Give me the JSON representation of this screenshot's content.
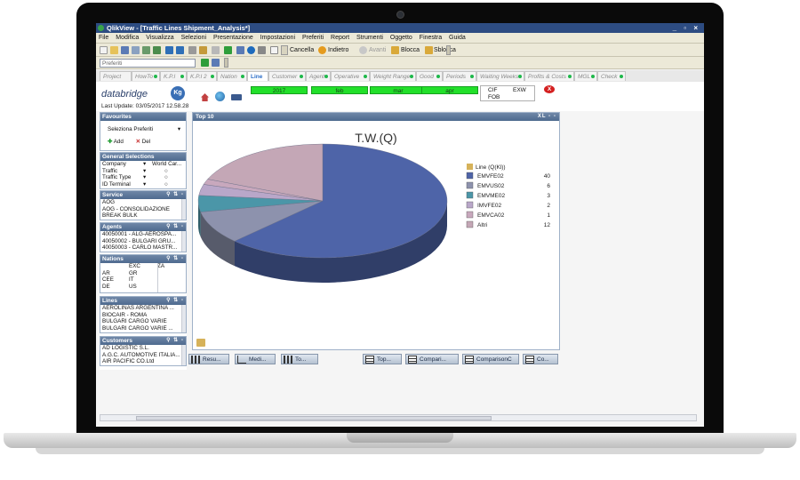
{
  "window": {
    "title": "QlikView - [Traffic Lines Shipment_Analysis*]",
    "controls": "_ ▫ ×"
  },
  "menu": [
    "File",
    "Modifica",
    "Visualizza",
    "Selezioni",
    "Presentazione",
    "Impostazioni",
    "Preferiti",
    "Report",
    "Strumenti",
    "Oggetto",
    "Finestra",
    "Guida"
  ],
  "toolbar": {
    "cancella": "Cancella",
    "indietro": "Indietro",
    "avanti": "Avanti",
    "blocca": "Blocca",
    "sblocca": "Sblocca"
  },
  "preferiti_placeholder": "Preferiti",
  "tabs": [
    {
      "label": "Project",
      "dot": false
    },
    {
      "label": "HowTo",
      "dot": true
    },
    {
      "label": "K.P.I",
      "dot": true
    },
    {
      "label": "K.P.I 2",
      "dot": true
    },
    {
      "label": "Nation",
      "dot": true
    },
    {
      "label": "Line",
      "dot": false,
      "active": true
    },
    {
      "label": "Customer",
      "dot": true
    },
    {
      "label": "Agent",
      "dot": true
    },
    {
      "label": "Operative",
      "dot": true
    },
    {
      "label": "Weight Range",
      "dot": true
    },
    {
      "label": "Good",
      "dot": true
    },
    {
      "label": "Periods",
      "dot": true
    },
    {
      "label": "Waiting Weeks",
      "dot": true
    },
    {
      "label": "Profits & Costs",
      "dot": true
    },
    {
      "label": "MGL",
      "dot": true
    },
    {
      "label": "Check",
      "dot": true
    }
  ],
  "brand": {
    "logo": "databridge",
    "badge": "Kg",
    "last_update": "Last Update: 03/05/2017 12.58.28"
  },
  "period_filters": [
    "2017",
    "feb",
    "mar",
    "apr"
  ],
  "incoterms": {
    "cif": "CIF",
    "exw": "EXW",
    "fob": "FOB"
  },
  "clear_button": "X",
  "favourites": {
    "title": "Favourites",
    "select_label": "Seleziona Preferiti",
    "add": "Add",
    "del": "Del"
  },
  "general_selections": {
    "title": "General Selections",
    "rows": [
      {
        "label": "Company",
        "value": "World Car..."
      },
      {
        "label": "Traffic",
        "value": ""
      },
      {
        "label": "Traffic Type",
        "value": ""
      },
      {
        "label": "ID Terminal",
        "value": ""
      }
    ]
  },
  "service": {
    "title": "Service",
    "items": [
      "AOG",
      "AOG - CONSOLIDAZIONE",
      "BREAK BULK"
    ]
  },
  "agents": {
    "title": "Agents",
    "items": [
      "40050001 - ALG-AEROSPA...",
      "40050002 - BULGARI GRU...",
      "40050003 - CARLO MASTR..."
    ]
  },
  "nations": {
    "title": "Nations",
    "headers": [
      "",
      "EXC",
      "ZA"
    ],
    "rows": [
      [
        "AR",
        "GR",
        ""
      ],
      [
        "CEE",
        "IT",
        ""
      ],
      [
        "DE",
        "US",
        ""
      ]
    ]
  },
  "lines": {
    "title": "Lines",
    "items": [
      "AEROLINAS ARGENTINA ...",
      "BIOCAIR - ROMA",
      "BULGARI CARGO VARIE",
      "BULGARI CARGO VARIE ..."
    ]
  },
  "customers": {
    "title": "Customers",
    "items": [
      "AD LOGISTIC S.L.",
      "A.G.C. AUTOMOTIVE ITALIA...",
      "AIR PACIFIC CO.Ltd"
    ]
  },
  "top10": {
    "title": "Top 10",
    "icons": "XL ▫ ▫"
  },
  "chart_data": {
    "type": "pie",
    "title": "T.W.(Q)",
    "legend_title": "Line (Q(Kl))",
    "legend_position": "right",
    "slices": [
      {
        "label": "EMVFE02",
        "value": 40,
        "color": "#4e64a8"
      },
      {
        "label": "EMVUS02",
        "value": 6,
        "color": "#8d92ad"
      },
      {
        "label": "EMVME02",
        "value": 3,
        "color": "#4b96a8"
      },
      {
        "label": "IMVFE02",
        "value": 2,
        "color": "#b9a7c9"
      },
      {
        "label": "EMVCA02",
        "value": 1,
        "color": "#c8a8bd"
      },
      {
        "label": "Altri",
        "value": 12,
        "color": "#c4a7b6"
      }
    ]
  },
  "bottom_tabs": [
    "Resu...",
    "Medi...",
    "To...",
    "Top...",
    "Compari...",
    "ComparisonC",
    "Co..."
  ]
}
